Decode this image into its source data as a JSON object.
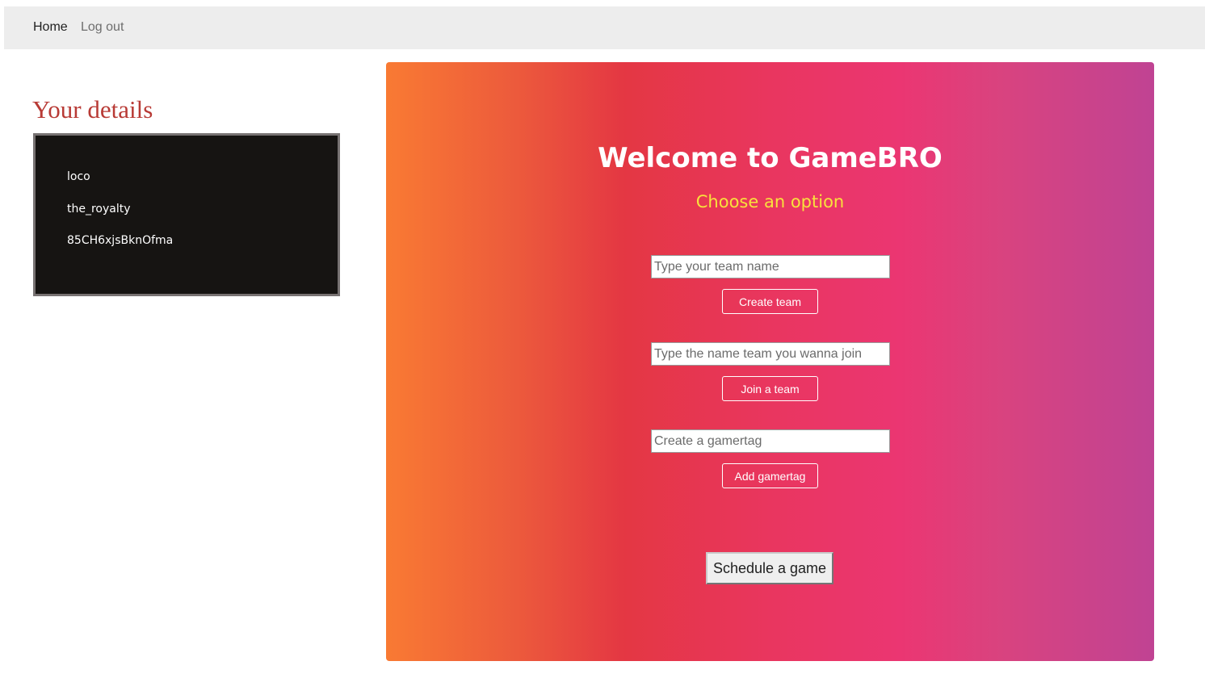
{
  "nav": {
    "home_label": "Home",
    "logout_label": "Log out"
  },
  "details": {
    "title": "Your details",
    "items": [
      "loco",
      "the_royalty",
      "85CH6xjsBknOfma"
    ]
  },
  "hero": {
    "title": "Welcome to GameBRO",
    "subtitle": "Choose an option",
    "team_name_placeholder": "Type your team name",
    "create_team_label": "Create team",
    "join_team_placeholder": "Type the name team you wanna join",
    "join_team_label": "Join a team",
    "gamertag_placeholder": "Create a gamertag",
    "add_gamertag_label": "Add gamertag",
    "schedule_label": "Schedule a game"
  },
  "colors": {
    "hero_gradient": [
      "#f97a33",
      "#e43743",
      "#eb3672",
      "#c04393"
    ],
    "details_title": "#b83a35",
    "subtitle": "#f8e23c",
    "details_box_bg": "#161412"
  }
}
